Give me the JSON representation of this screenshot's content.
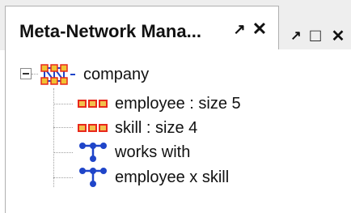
{
  "panel": {
    "tab_title": "Meta-Network Mana...",
    "tab_buttons": {
      "undock": "↗",
      "close": "✕"
    },
    "window_buttons": {
      "restore": "↗",
      "maximize": "□",
      "close": "✕"
    }
  },
  "tree": {
    "root": {
      "label": "company",
      "expander": "⊟",
      "icon": "meta-network-icon"
    },
    "children": [
      {
        "label": "employee : size 5",
        "icon": "nodeset-icon"
      },
      {
        "label": "skill : size 4",
        "icon": "nodeset-icon"
      },
      {
        "label": "works with",
        "icon": "network-icon"
      },
      {
        "label": "employee x skill",
        "icon": "network-icon"
      }
    ]
  },
  "colors": {
    "nodeset_red": "#e8281c",
    "nodeset_fill": "#f2c04c",
    "network_blue": "#1f45c9",
    "root_gold": "#f1c232"
  }
}
